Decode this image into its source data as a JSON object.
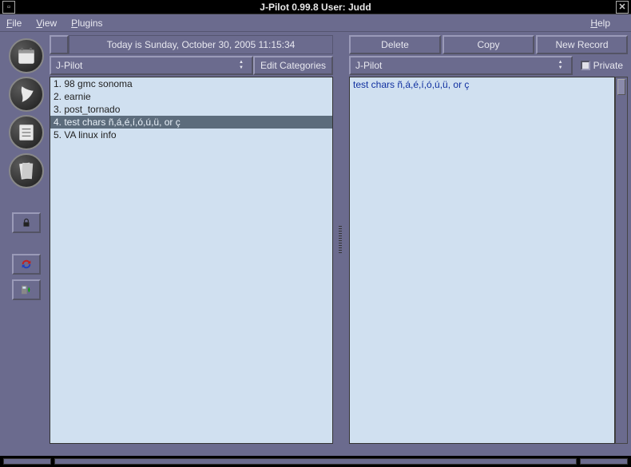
{
  "titlebar": {
    "title": "J-Pilot 0.99.8 User:  Judd"
  },
  "menubar": {
    "file": "File",
    "view": "View",
    "plugins": "Plugins",
    "help": "Help"
  },
  "today_label": "Today is Sunday, October 30, 2005 11:15:34",
  "left": {
    "combo_label": "J-Pilot",
    "edit_categories": "Edit Categories",
    "items": [
      "1. 98 gmc sonoma",
      "2. earnie",
      "3. post_tornado",
      "4. test chars ñ,á,é,í,ó,ú,ü, or ç",
      "5. VA linux info"
    ],
    "selected_index": 3
  },
  "right": {
    "btn_delete": "Delete",
    "btn_copy": "Copy",
    "btn_new": "New Record",
    "combo_label": "J-Pilot",
    "private_label": "Private",
    "editor_text": "test chars ñ,á,é,í,ó,ú,ü, or ç"
  },
  "side_icons": [
    "datebook-icon",
    "address-icon",
    "todo-icon",
    "memo-icon"
  ],
  "side_buttons": [
    "lock-icon",
    "sync-icon",
    "backup-icon"
  ]
}
